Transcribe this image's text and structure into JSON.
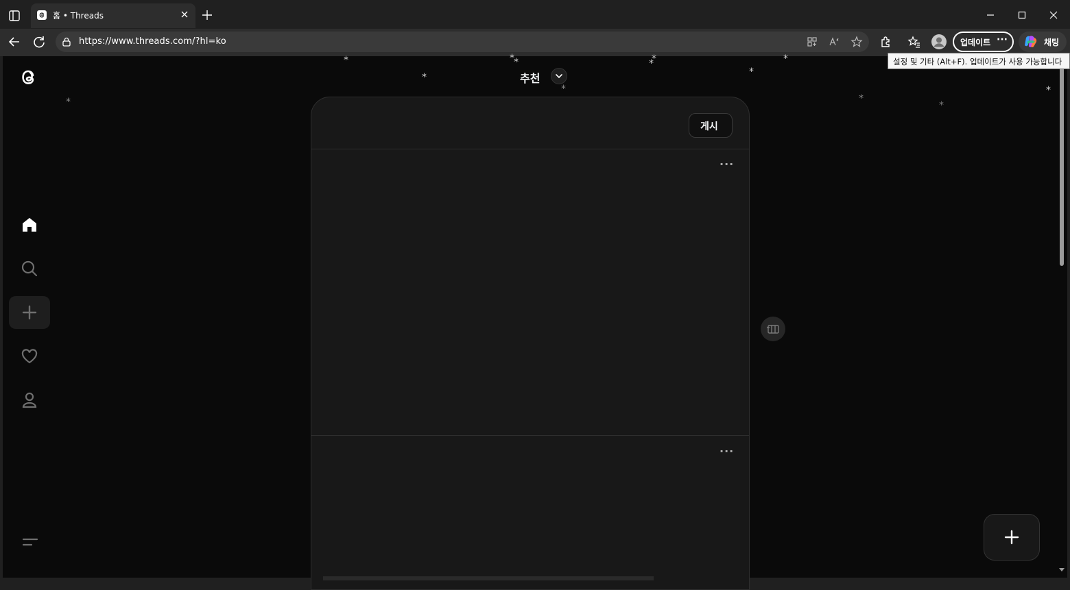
{
  "browser": {
    "tab_title": "홈 • Threads",
    "url": "https://www.threads.com/?hl=ko",
    "update_button": "업데이트",
    "update_more": "···",
    "copilot_button": "채팅",
    "tooltip": "설정 및 기타 (Alt+F). 업데이트가 사용 가능합니다"
  },
  "sidebar": {
    "items": [
      {
        "name": "home",
        "icon": "home-icon"
      },
      {
        "name": "search",
        "icon": "search-icon"
      },
      {
        "name": "create",
        "icon": "plus-icon"
      },
      {
        "name": "activity",
        "icon": "heart-icon"
      },
      {
        "name": "profile",
        "icon": "user-icon"
      }
    ],
    "menu_icon": "menu-icon"
  },
  "feed": {
    "title": "추천",
    "post_button": "게시",
    "more_label": "···"
  },
  "colors": {
    "page_bg": "#0a0a0a",
    "card_bg": "#181818",
    "chrome_bg": "#202020",
    "toolbar_bg": "#2d2d2d"
  }
}
